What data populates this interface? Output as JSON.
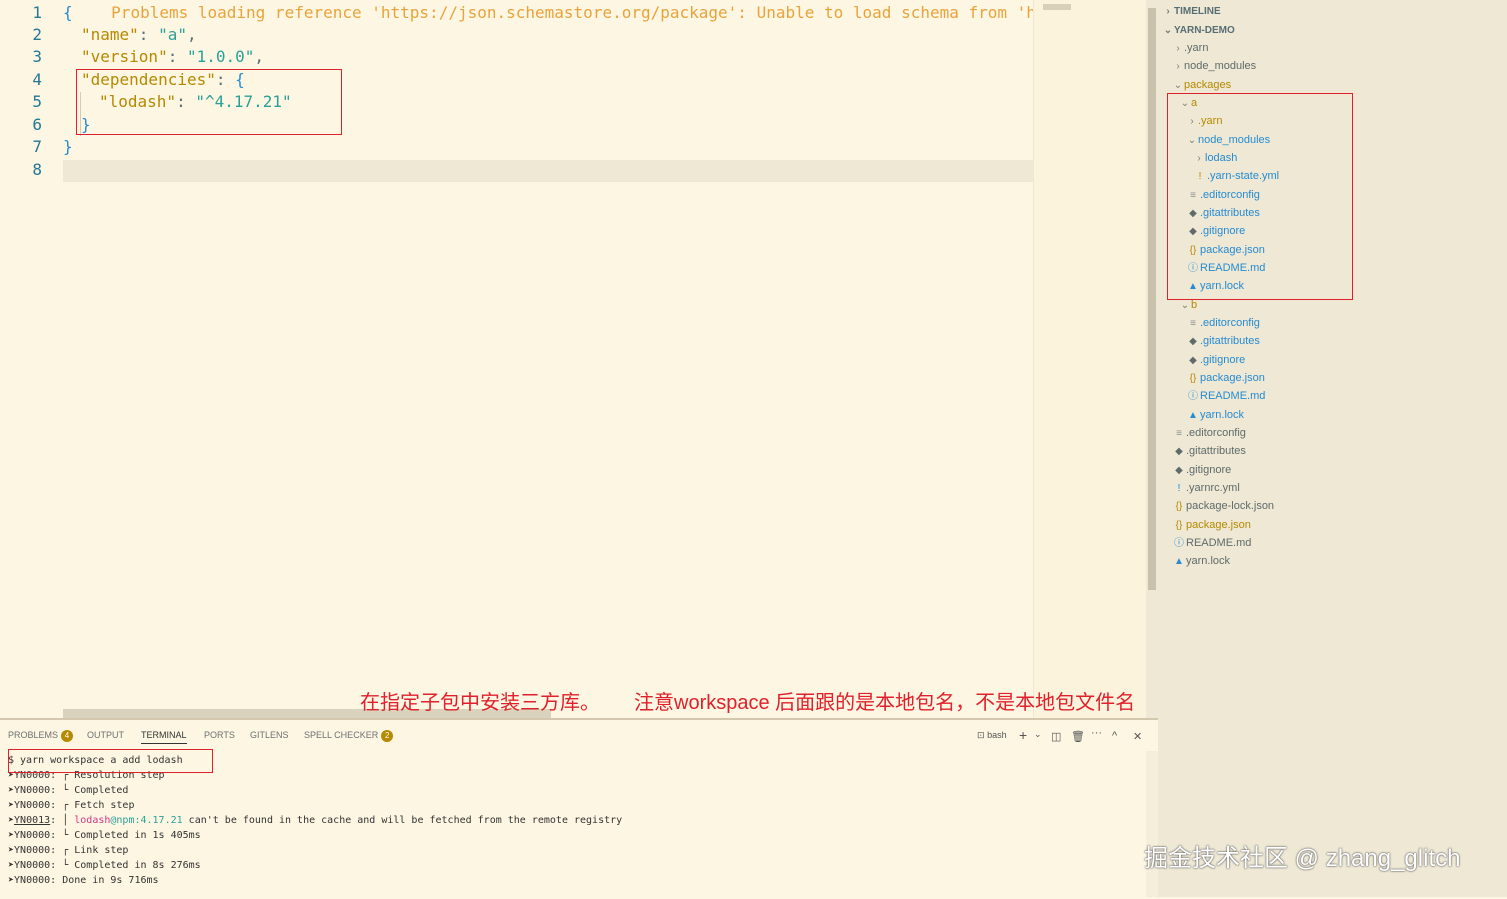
{
  "editor": {
    "line_numbers": [
      "1",
      "2",
      "3",
      "4",
      "5",
      "6",
      "7",
      "8"
    ],
    "line1_brace": "{",
    "warning": "Problems loading reference 'https://json.schemastore.org/package': Unable to load schema from 'https:",
    "name_key": "\"name\"",
    "name_val": "\"a\"",
    "version_key": "\"version\"",
    "version_val": "\"1.0.0\"",
    "deps_key": "\"dependencies\"",
    "lodash_key": "\"lodash\"",
    "lodash_val": "\"^4.17.21\""
  },
  "annotation": {
    "left": "在指定子包中安装三方库。",
    "right": "注意workspace 后面跟的是本地包名，不是本地包文件名"
  },
  "explorer": {
    "timeline": "TIMELINE",
    "project": "YARN-DEMO",
    "items": [
      {
        "label": ".yarn"
      },
      {
        "label": "node_modules"
      },
      {
        "label": "packages"
      },
      {
        "label": "a"
      },
      {
        "label": ".yarn"
      },
      {
        "label": "node_modules"
      },
      {
        "label": "lodash"
      },
      {
        "label": ".yarn-state.yml",
        "icon": "!"
      },
      {
        "label": ".editorconfig",
        "icon": "≡"
      },
      {
        "label": ".gitattributes",
        "icon": "◆"
      },
      {
        "label": ".gitignore",
        "icon": "◆"
      },
      {
        "label": "package.json",
        "icon": "{}"
      },
      {
        "label": "README.md",
        "icon": "ⓘ"
      },
      {
        "label": "yarn.lock",
        "icon": "▲"
      },
      {
        "label": "b"
      },
      {
        "label": ".editorconfig",
        "icon": "≡"
      },
      {
        "label": ".gitattributes",
        "icon": "◆"
      },
      {
        "label": ".gitignore",
        "icon": "◆"
      },
      {
        "label": "package.json",
        "icon": "{}"
      },
      {
        "label": "README.md",
        "icon": "ⓘ"
      },
      {
        "label": "yarn.lock",
        "icon": "▲"
      },
      {
        "label": ".editorconfig",
        "icon": "≡"
      },
      {
        "label": ".gitattributes",
        "icon": "◆"
      },
      {
        "label": ".gitignore",
        "icon": "◆"
      },
      {
        "label": ".yarnrc.yml",
        "icon": "!"
      },
      {
        "label": "package-lock.json",
        "icon": "{}"
      },
      {
        "label": "package.json",
        "icon": "{}"
      },
      {
        "label": "README.md",
        "icon": "ⓘ"
      },
      {
        "label": "yarn.lock",
        "icon": "▲"
      }
    ]
  },
  "panel": {
    "tabs": [
      "PROBLEMS",
      "OUTPUT",
      "TERMINAL",
      "PORTS",
      "GITLENS",
      "SPELL CHECKER"
    ],
    "problems_count": "4",
    "spell_count": "2",
    "shell": "bash",
    "terminal": {
      "command": "$ yarn workspace a add lodash",
      "lines": [
        {
          "code": "YN0000",
          "text": "Resolution step",
          "bracket": "┌"
        },
        {
          "code": "YN0000",
          "text": "Completed",
          "bracket": "└"
        },
        {
          "code": "YN0000",
          "text": "Fetch step",
          "bracket": "┌"
        },
        {
          "code": "YN0013",
          "bracket": "│",
          "pkg": "lodash",
          "at": "@npm:",
          "ver": "4.17.21",
          "rest": " can't be found in the cache and will be fetched from the remote registry"
        },
        {
          "code": "YN0000",
          "text": "Completed in 1s 405ms",
          "bracket": "└"
        },
        {
          "code": "YN0000",
          "text": "Link step",
          "bracket": "┌"
        },
        {
          "code": "YN0000",
          "text": "Completed in 8s 276ms",
          "bracket": "└"
        },
        {
          "code": "YN0000",
          "text": "Done in 9s 716ms",
          "bracket": ""
        }
      ]
    }
  },
  "watermark": "掘金技术社区 @ zhang_glitch"
}
